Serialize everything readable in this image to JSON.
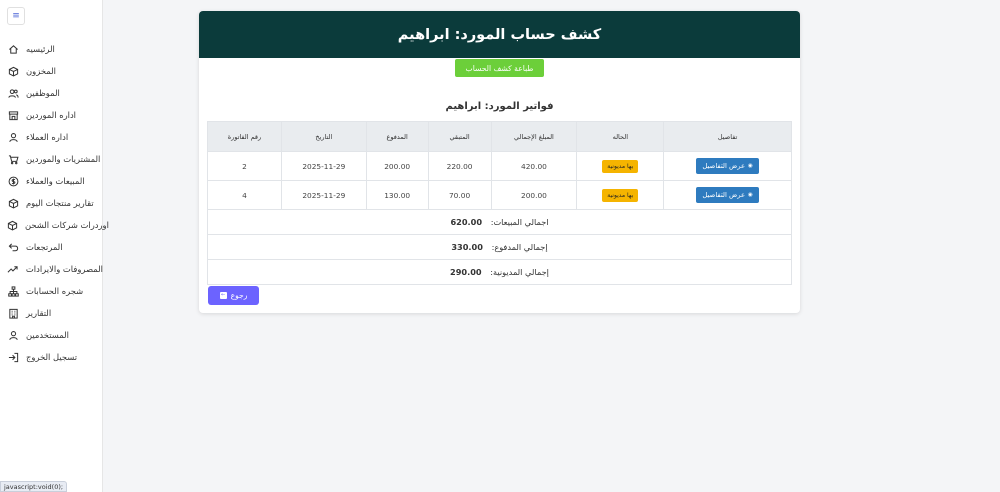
{
  "sidebar": {
    "toggle_icon": "≡",
    "items": [
      {
        "label": "الرئيسيه",
        "icon": "home-icon"
      },
      {
        "label": "المخزون",
        "icon": "box-icon"
      },
      {
        "label": "الموظفين",
        "icon": "users-icon"
      },
      {
        "label": "اداره الموردين",
        "icon": "store-icon"
      },
      {
        "label": "اداره العملاء",
        "icon": "user-icon"
      },
      {
        "label": "المشتريات والموردين",
        "icon": "cart-icon"
      },
      {
        "label": "المبيعات والعملاء",
        "icon": "dollar-icon"
      },
      {
        "label": "تقارير منتجات اليوم",
        "icon": "box-icon"
      },
      {
        "label": "اوردرات شركات الشحن",
        "icon": "box-icon"
      },
      {
        "label": "المرتجعات",
        "icon": "return-icon"
      },
      {
        "label": "المصروفات والايرادات",
        "icon": "trend-icon"
      },
      {
        "label": "شجره الحسابات",
        "icon": "tree-icon"
      },
      {
        "label": "التقارير",
        "icon": "building-icon"
      },
      {
        "label": "المستخدمين",
        "icon": "user-icon"
      },
      {
        "label": "تسجيل الخروج",
        "icon": "logout-icon"
      }
    ]
  },
  "status_url": "javascript:void(0);",
  "header": {
    "title": "كشف حساب المورد: ابراهيم"
  },
  "print_button": "طباعة كشف الحساب",
  "subtitle": "فواتير المورد: ابراهيم",
  "table": {
    "headers": {
      "details": "تفاصيل",
      "status": "الحاله",
      "total": "المبلغ الإجمالي",
      "remaining": "المتبقي",
      "paid": "المدفوع",
      "date": "التاريخ",
      "invoice": "رقم الفاتورة"
    },
    "rows": [
      {
        "details": "عرض التفاصيل",
        "status": "بها مديونية",
        "total": "420.00",
        "remaining": "220.00",
        "paid": "200.00",
        "date": "2025-11-29",
        "invoice": "2"
      },
      {
        "details": "عرض التفاصيل",
        "status": "بها مديونية",
        "total": "200.00",
        "remaining": "70.00",
        "paid": "130.00",
        "date": "2025-11-29",
        "invoice": "4"
      }
    ],
    "totals": [
      {
        "label": "اجمالي المبيعات:",
        "value": "620.00"
      },
      {
        "label": "إجمالي المدفوع:",
        "value": "330.00"
      },
      {
        "label": "إجمالي المديونية:",
        "value": "290.00"
      }
    ]
  },
  "back_button": "رجوع",
  "colors": {
    "header_bg": "#0b3b3b",
    "print_btn": "#6ccf3a",
    "badge": "#f5b400",
    "details_btn": "#2e7bbf",
    "back_btn": "#6c63ff"
  }
}
